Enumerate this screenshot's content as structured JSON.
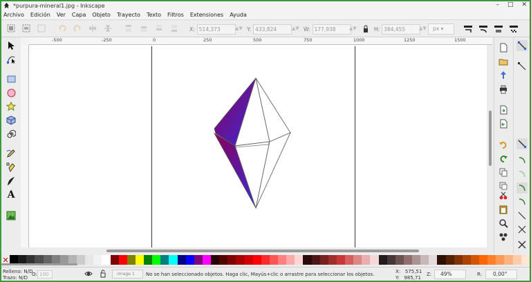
{
  "window": {
    "title": "*purpura-mineral1.jpg - Inkscape",
    "controls": [
      "–",
      "□",
      "✕"
    ]
  },
  "menu": [
    "Archivo",
    "Edición",
    "Ver",
    "Capa",
    "Objeto",
    "Trayecto",
    "Texto",
    "Filtros",
    "Extensiones",
    "Ayuda"
  ],
  "toolbar": {
    "x_label": "X:",
    "x_value": "514,373",
    "y_label": "Y:",
    "y_value": "433,824",
    "w_label": "W:",
    "w_value": "177,938",
    "h_label": "H:",
    "h_value": "384,455",
    "unit": "px"
  },
  "ruler": {
    "ticks": [
      "-500",
      "-250",
      "0",
      "250",
      "500",
      "750",
      "1000",
      "1250",
      "1500"
    ]
  },
  "palette": {
    "none_symbol": "✕",
    "colors": [
      "#000000",
      "#1a1a1a",
      "#333333",
      "#4d4d4d",
      "#666666",
      "#808080",
      "#999999",
      "#b3b3b3",
      "#cccccc",
      "#e6e6e6",
      "#f2f2f2",
      "#ffffff",
      "#800000",
      "#ff0000",
      "#808000",
      "#ffff00",
      "#008000",
      "#00ff00",
      "#008080",
      "#00ffff",
      "#000080",
      "#0000ff",
      "#800080",
      "#ff00ff",
      "#2b0000",
      "#550000",
      "#800000",
      "#aa0000",
      "#d40000",
      "#ff0000",
      "#ff2a2a",
      "#ff5555",
      "#ff8080",
      "#ffaaaa",
      "#ffd5d5",
      "#280b0b",
      "#501616",
      "#782121",
      "#a02c2c",
      "#c83737",
      "#d35f5f",
      "#de8787",
      "#e9afaf",
      "#f4d7d7",
      "#241c1c",
      "#483737",
      "#6c5353",
      "#916f6f",
      "#ac9393",
      "#c8b7b7",
      "#e3dbdb",
      "#2b1100",
      "#552200",
      "#803300",
      "#aa4400",
      "#d45500",
      "#ff6600",
      "#ff7f2a",
      "#ff9955",
      "#ffb380",
      "#ffccaa",
      "#ffe6d5"
    ]
  },
  "status": {
    "fill_label": "Relleno:",
    "fill_value": "N/D",
    "stroke_label": "Trazo:",
    "stroke_value": "N/D",
    "opacity_label": "O:",
    "opacity_value": "100",
    "layer": "-Image 1",
    "message": "No se han seleccionado objetos. Haga clic, Mayús+clic o arrastre para seleccionar los objetos.",
    "x_label": "X:",
    "x_value": "575,51",
    "y_label": "Y:",
    "y_value": "985,71",
    "zoom_label": "Z:",
    "zoom_value": "49%",
    "rotation_label": "R:",
    "rotation_value": "0,00°"
  },
  "colors": {
    "gradient_start": "#8a005a",
    "gradient_end": "#3b2bd6",
    "window_border": "#3a9a3a"
  }
}
